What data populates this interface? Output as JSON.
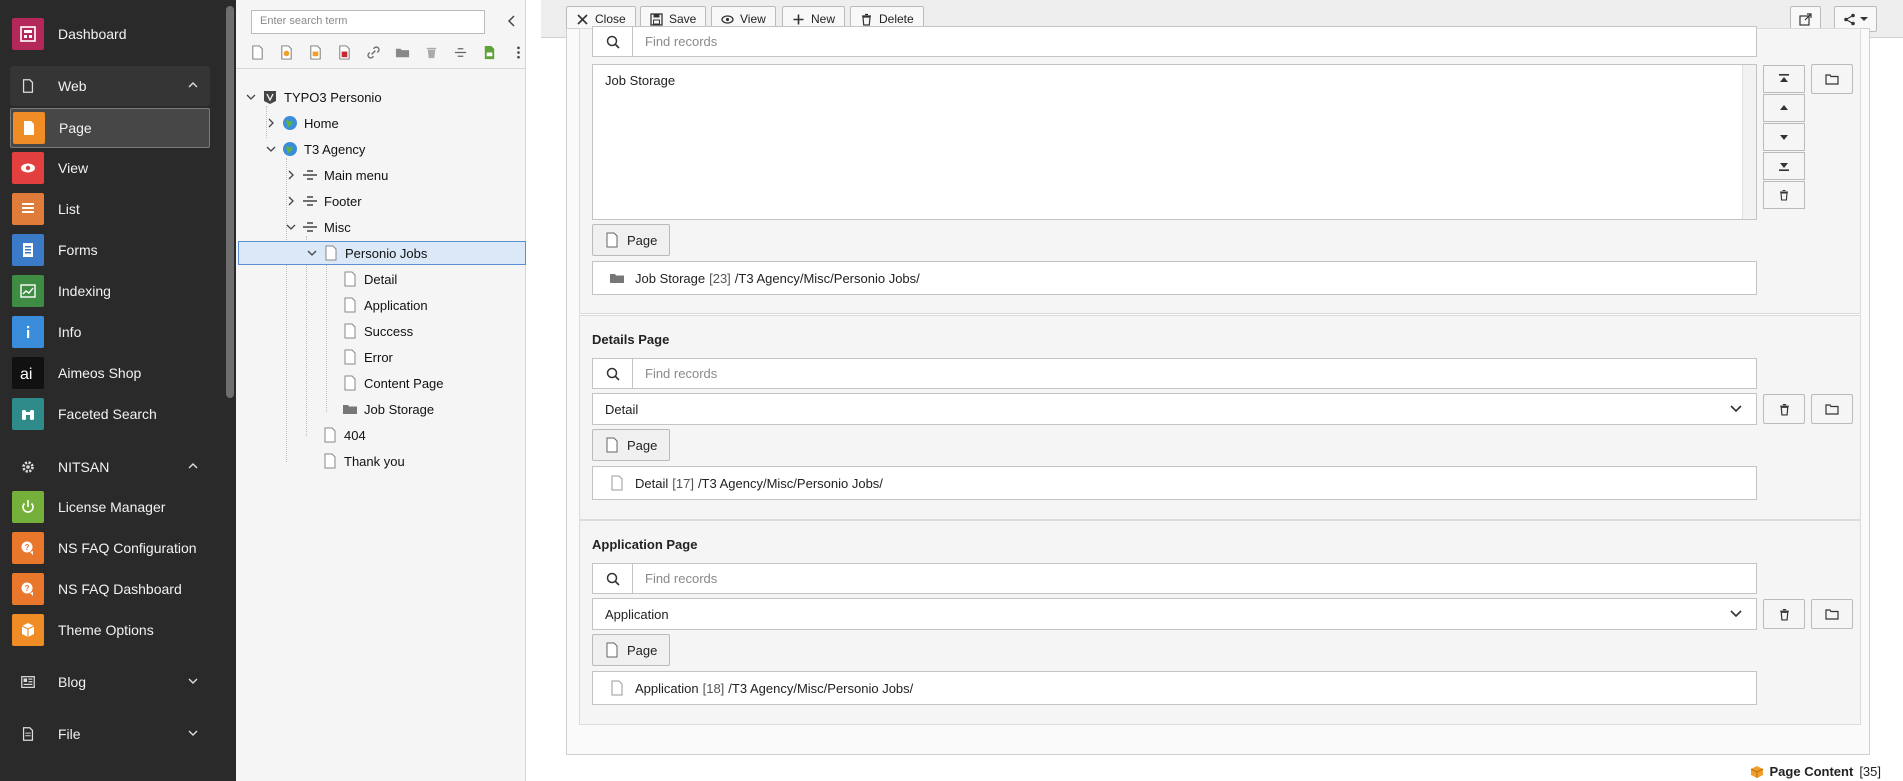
{
  "module_menu": {
    "items": [
      {
        "label": "Dashboard",
        "icon": "dashboard-icon",
        "color": "#b3275a"
      },
      {
        "label": "Page",
        "icon": "page-icon",
        "color": "#f08c25"
      },
      {
        "label": "View",
        "icon": "eye-icon",
        "color": "#e23f3f"
      },
      {
        "label": "List",
        "icon": "list-icon",
        "color": "#e07c3a"
      },
      {
        "label": "Forms",
        "icon": "forms-icon",
        "color": "#3a7ac7"
      },
      {
        "label": "Indexing",
        "icon": "chart-icon",
        "color": "#3f8c44"
      },
      {
        "label": "Info",
        "icon": "info-icon",
        "color": "#3a8ddb"
      },
      {
        "label": "Aimeos Shop",
        "icon": "aimeos-icon",
        "color": "#111111"
      },
      {
        "label": "Faceted Search",
        "icon": "binoculars-icon",
        "color": "#2f8a8a"
      },
      {
        "label": "License Manager",
        "icon": "power-icon",
        "color": "#74b03a"
      },
      {
        "label": "NS FAQ Configuration",
        "icon": "faq-icon",
        "color": "#e8772c"
      },
      {
        "label": "NS FAQ Dashboard",
        "icon": "faq-icon",
        "color": "#e8772c"
      },
      {
        "label": "Theme Options",
        "icon": "box-icon",
        "color": "#f08c25"
      }
    ],
    "groups": {
      "web": "Web",
      "nitsan": "NITSAN",
      "blog": "Blog",
      "file": "File"
    }
  },
  "tree": {
    "search_placeholder": "Enter search term",
    "nodes": [
      {
        "label": "TYPO3 Personio"
      },
      {
        "label": "Home"
      },
      {
        "label": "T3 Agency"
      },
      {
        "label": "Main menu"
      },
      {
        "label": "Footer"
      },
      {
        "label": "Misc"
      },
      {
        "label": "Personio Jobs"
      },
      {
        "label": "Detail"
      },
      {
        "label": "Application"
      },
      {
        "label": "Success"
      },
      {
        "label": "Error"
      },
      {
        "label": "Content Page"
      },
      {
        "label": "Job Storage"
      },
      {
        "label": "404"
      },
      {
        "label": "Thank you"
      }
    ]
  },
  "toolbar": {
    "close": "Close",
    "save": "Save",
    "view": "View",
    "new": "New",
    "delete": "Delete"
  },
  "form": {
    "storage": {
      "find_placeholder": "Find records",
      "selected_item": "Job Storage",
      "page_button": "Page",
      "record_title": "Job Storage",
      "record_uid": "[23]",
      "record_path": "/T3 Agency/Misc/Personio Jobs/"
    },
    "details": {
      "label": "Details Page",
      "find_placeholder": "Find records",
      "selected": "Detail",
      "page_button": "Page",
      "record_title": "Detail",
      "record_uid": "[17]",
      "record_path": "/T3 Agency/Misc/Personio Jobs/"
    },
    "application": {
      "label": "Application Page",
      "find_placeholder": "Find records",
      "selected": "Application",
      "page_button": "Page",
      "record_title": "Application",
      "record_uid": "[18]",
      "record_path": "/T3 Agency/Misc/Personio Jobs/"
    }
  },
  "status": {
    "label": "Page Content",
    "count": "[35]"
  }
}
